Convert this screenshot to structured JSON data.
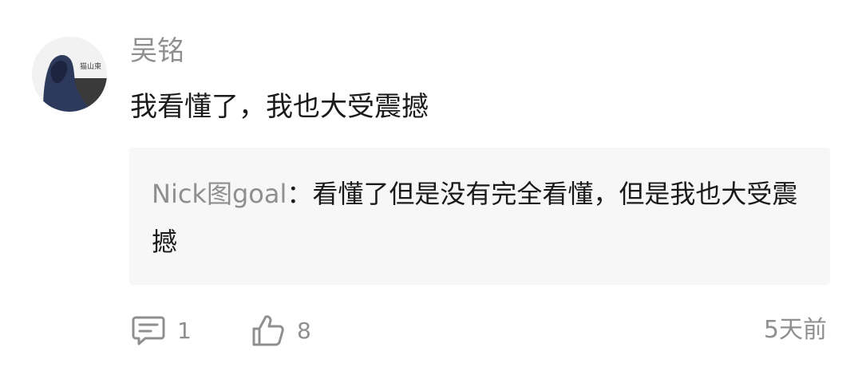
{
  "comment": {
    "username": "吴铭",
    "text": "我看懂了，我也大受震撼",
    "avatar_icon": "hooded-figure-avatar"
  },
  "reply": {
    "author": "Nick图goal",
    "separator": "：",
    "text": "看懂了但是没有完全看懂，但是我也大受震撼"
  },
  "actions": {
    "comment_icon": "comment-bubble-icon",
    "comment_count": "1",
    "like_icon": "thumbs-up-icon",
    "like_count": "8"
  },
  "timestamp": "5天前",
  "colors": {
    "secondary_text": "#8f8f8f",
    "primary_text": "#1a1a1a",
    "reply_background": "#f7f7f7"
  }
}
